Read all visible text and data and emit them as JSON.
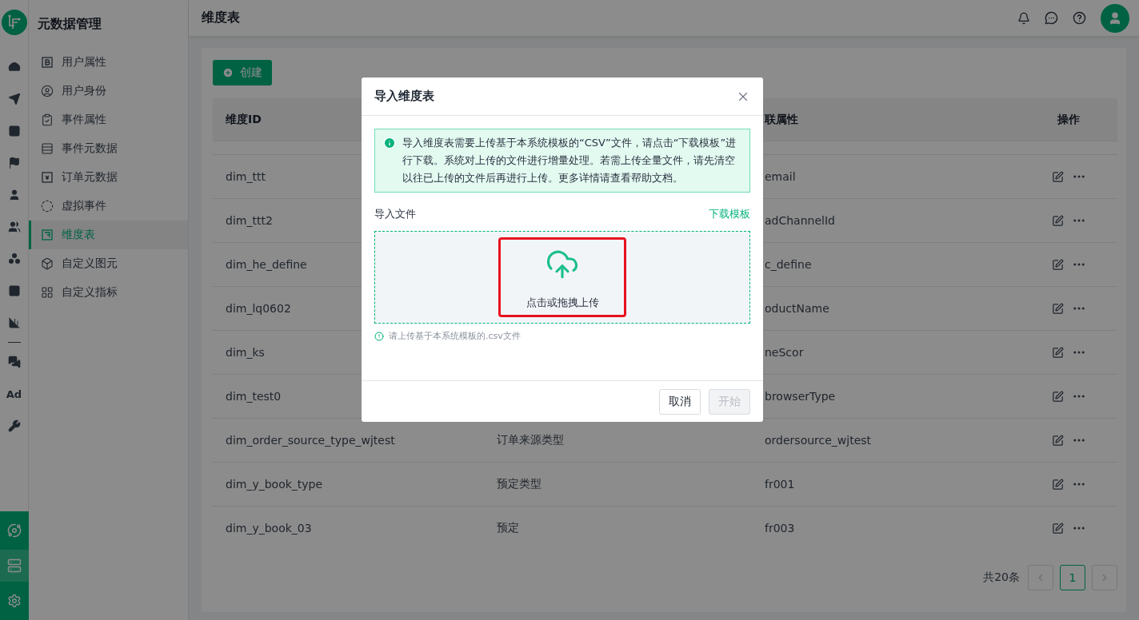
{
  "rail": {
    "ad_text": "Ad",
    "bottom_items": [
      {
        "selected": false
      },
      {
        "selected": true
      },
      {
        "selected": false
      }
    ]
  },
  "sidebar": {
    "title": "元数据管理",
    "items": [
      {
        "label": "用户属性",
        "selected": false
      },
      {
        "label": "用户身份",
        "selected": false
      },
      {
        "label": "事件属性",
        "selected": false
      },
      {
        "label": "事件元数据",
        "selected": false
      },
      {
        "label": "订单元数据",
        "selected": false
      },
      {
        "label": "虚拟事件",
        "selected": false
      },
      {
        "label": "维度表",
        "selected": true
      },
      {
        "label": "自定义图元",
        "selected": false
      },
      {
        "label": "自定义指标",
        "selected": false
      }
    ]
  },
  "header": {
    "title": "维度表"
  },
  "toolbar": {
    "create_button": "创建"
  },
  "table": {
    "columns": [
      {
        "label": "维度ID"
      },
      {},
      {
        "label": "联属性"
      },
      {
        "label": "操作"
      }
    ],
    "rows": [
      {
        "column_1": "dim_ttt",
        "column_3": "email"
      },
      {
        "column_1": "dim_ttt2",
        "column_3": "adChannelId"
      },
      {
        "column_1": "dim_he_define",
        "column_3": "c_define"
      },
      {
        "column_1": "dim_lq0602",
        "column_3": "oductName"
      },
      {
        "column_1": "dim_ks",
        "column_3": "neScor"
      },
      {
        "column_1": "dim_test0",
        "column_3": "browserType"
      },
      {
        "column_1": "dim_order_source_type_wjtest",
        "column_2": "订单来源类型",
        "column_3": "ordersource_wjtest"
      },
      {
        "column_1": "dim_y_book_type",
        "column_2": "预定类型",
        "column_3": "fr001"
      },
      {
        "column_1": "dim_y_book_03",
        "column_2": "预定",
        "column_3": "fr003"
      }
    ]
  },
  "pagination": {
    "total": "共20条",
    "prev": {
      "disabled": true
    },
    "pages": [
      {
        "label": "1",
        "selected": true
      }
    ],
    "next": {
      "disabled": true
    }
  },
  "modal": {
    "title": "导入维度表",
    "alert": "导入维度表需要上传基于本系统模板的“CSV”文件，请点击“下载模板”进行下载。系统对上传的文件进行增量处理。若需上传全量文件，请先清空以往已上传的文件后再进行上传。更多详情请查看帮助文档。",
    "file_label": "导入文件",
    "download_link": "下载模板",
    "upload_text": "点击或拖拽上传",
    "hint": "请上传基于本系统模板的.csv文件",
    "buttons": [
      {
        "label": "取消",
        "disabled": false
      },
      {
        "label": "开始",
        "disabled": true
      }
    ]
  }
}
